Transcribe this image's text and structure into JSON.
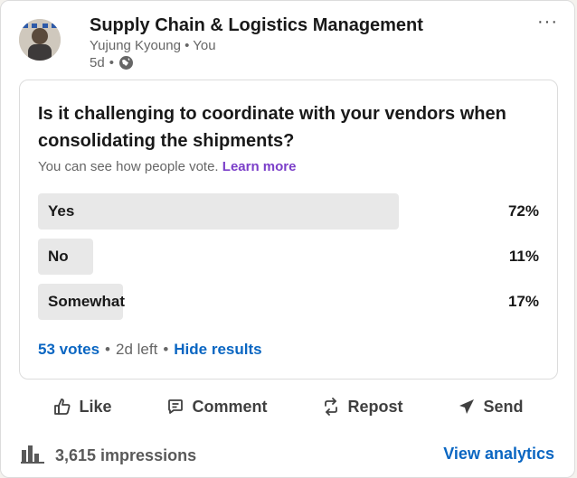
{
  "post": {
    "group_title": "Supply Chain & Logistics Management",
    "author": "Yujung Kyoung",
    "author_relation": "You",
    "bullet": "•",
    "age": "5d",
    "more_label": "···"
  },
  "poll": {
    "question": "Is it challenging to coordinate with your vendors when consolidating the shipments?",
    "visibility_text": "You can see how people vote.",
    "learn_more": "Learn more",
    "options": [
      {
        "label": "Yes",
        "percent_text": "72%",
        "percent": 72
      },
      {
        "label": "No",
        "percent_text": "11%",
        "percent": 11
      },
      {
        "label": "Somewhat",
        "percent_text": "17%",
        "percent": 17
      }
    ],
    "votes": "53 votes",
    "time_left": "2d left",
    "hide_results": "Hide results"
  },
  "actions": {
    "like": "Like",
    "comment": "Comment",
    "repost": "Repost",
    "send": "Send"
  },
  "footer": {
    "impressions": "3,615 impressions",
    "view_analytics": "View analytics"
  },
  "colors": {
    "link_blue": "#0a66c2",
    "learn_more_purple": "#7b3fc9",
    "poll_fill": "#e8e8e8"
  },
  "icons": {
    "globe": "globe-icon",
    "like": "thumbs-up-icon",
    "comment": "comment-icon",
    "repost": "repost-icon",
    "send": "send-icon",
    "analytics": "bar-chart-icon"
  }
}
